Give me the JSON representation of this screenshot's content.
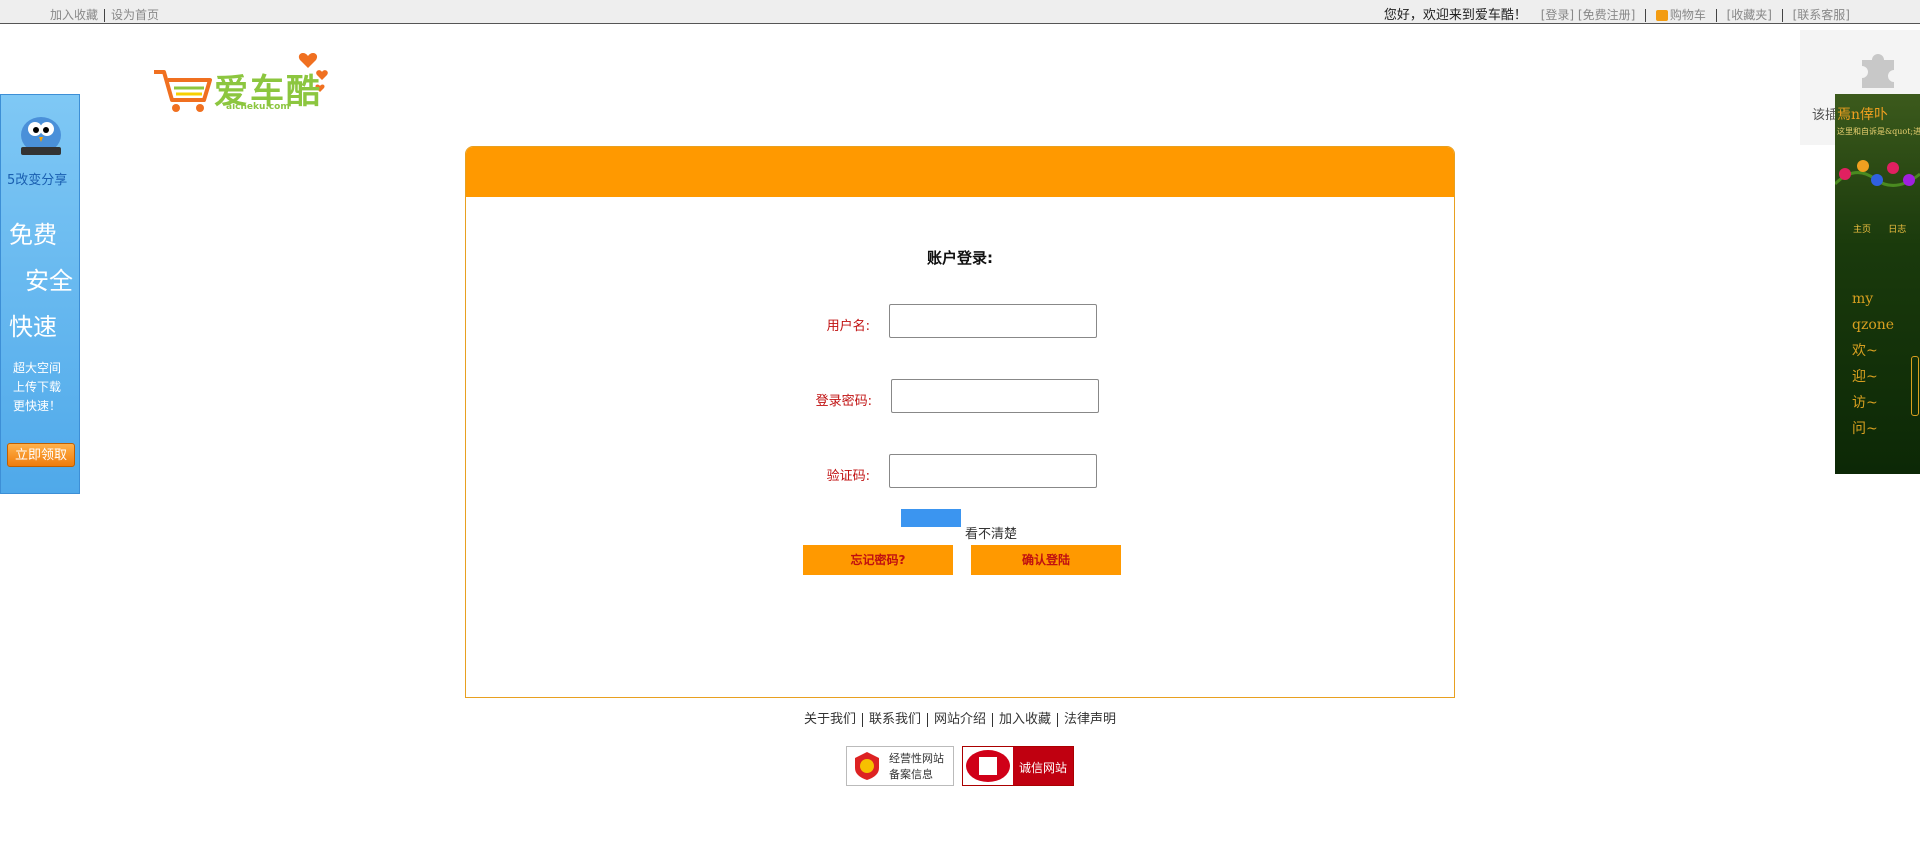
{
  "topbar": {
    "left_links": [
      "加入收藏",
      "设为首页"
    ],
    "welcome": "您好，欢迎来到爱车酷！",
    "login": "[登录]",
    "register": "[免费注册]",
    "cart": "购物车",
    "favorites": "[收藏夹]",
    "service": "[联系客服]"
  },
  "logo": {
    "name": "爱车酷",
    "domain": "aicheku.com",
    "colors": {
      "cart": "#f07020",
      "text": "#8cc63f",
      "hearts": "#f07020"
    }
  },
  "left_ad": {
    "brand": "5改变分享",
    "line1": "免费",
    "line2": "安全",
    "line3": "快速",
    "small_lines": [
      "超大空间",
      "上传下载",
      "更快速！"
    ],
    "button": "立即领取"
  },
  "right_top": {
    "text": "该插",
    "icon": "puzzle-icon"
  },
  "right_widget": {
    "title": "焉n倖卟",
    "subtitle": "这里和自诉是&quot;进",
    "links": [
      "主页",
      "日志"
    ],
    "poem": [
      "my",
      "qzone",
      "欢~",
      "迎~",
      "访~",
      "问~"
    ]
  },
  "login": {
    "title": "账户登录:",
    "username_label": "用户名:",
    "username_value": "",
    "password_label": "登录密码:",
    "password_value": "",
    "captcha_label": "验证码:",
    "captcha_value": "",
    "captcha_refresh": "看不清楚",
    "forgot_button": "忘记密码?",
    "submit_button": "确认登陆",
    "header_color": "#ff9900",
    "label_color": "#c01010"
  },
  "footer": {
    "links": [
      "关于我们",
      "联系我们",
      "网站介绍",
      "加入收藏",
      "法律声明"
    ],
    "badge1_lines": [
      "经营性网站",
      "备案信息"
    ],
    "badge2_text": "诚信网站"
  }
}
